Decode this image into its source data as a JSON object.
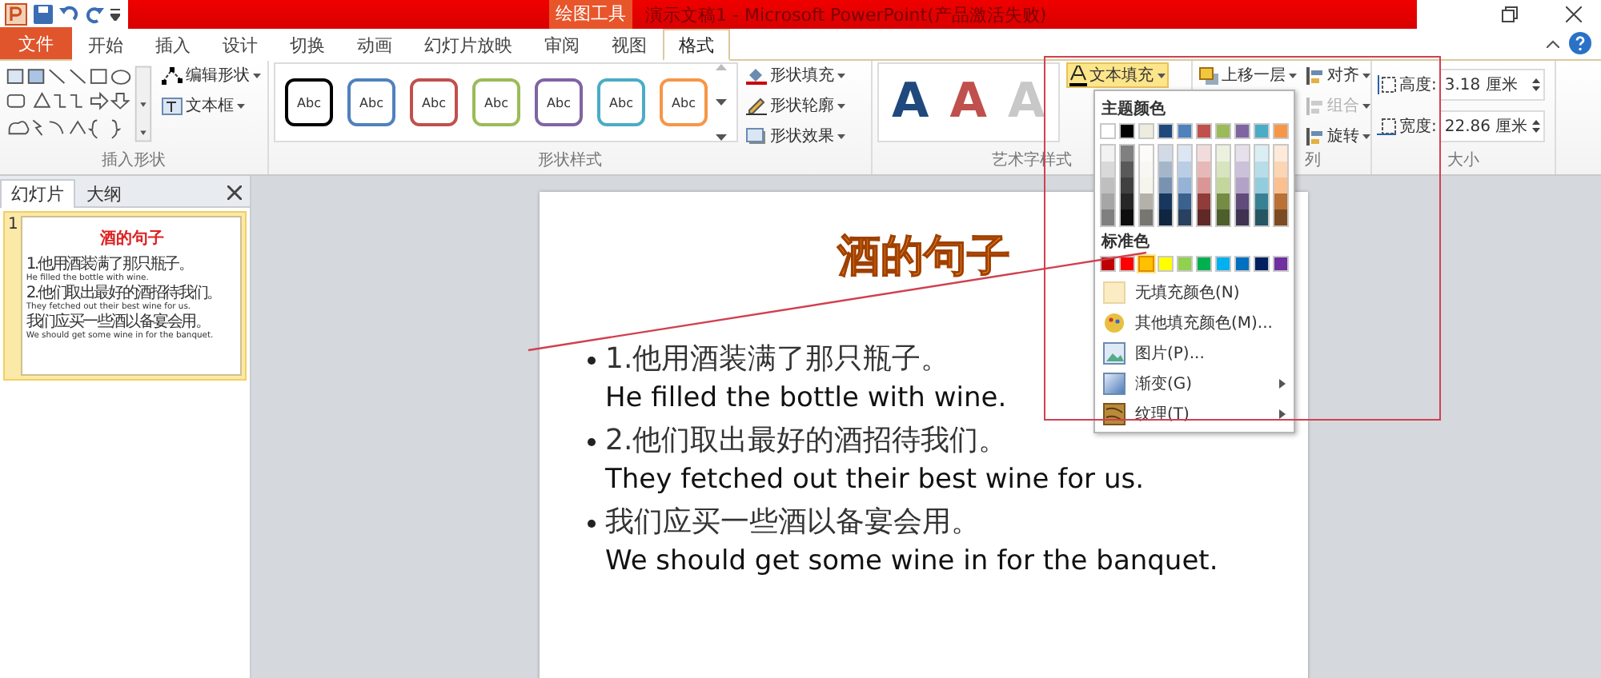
{
  "title_bar": {
    "context_label": "绘图工具",
    "title": "演示文稿1 - Microsoft PowerPoint(产品激活失败)"
  },
  "ribbon_tabs": [
    {
      "label": "文件",
      "kind": "file",
      "selected": false
    },
    {
      "label": "开始",
      "kind": "tab",
      "selected": false
    },
    {
      "label": "插入",
      "kind": "tab",
      "selected": false
    },
    {
      "label": "设计",
      "kind": "tab",
      "selected": false
    },
    {
      "label": "切换",
      "kind": "tab",
      "selected": false
    },
    {
      "label": "动画",
      "kind": "tab",
      "selected": false
    },
    {
      "label": "幻灯片放映",
      "kind": "tab",
      "selected": false
    },
    {
      "label": "审阅",
      "kind": "tab",
      "selected": false
    },
    {
      "label": "视图",
      "kind": "tab",
      "selected": false
    },
    {
      "label": "格式",
      "kind": "tab",
      "selected": true
    }
  ],
  "insert_shapes": {
    "label": "插入形状",
    "buttons": [
      "编辑形状",
      "文本框"
    ]
  },
  "shape_styles": {
    "label": "形状样式",
    "styles": [
      {
        "label": "Abc",
        "color": "#000000"
      },
      {
        "label": "Abc",
        "color": "#4f81bd"
      },
      {
        "label": "Abc",
        "color": "#c0504d"
      },
      {
        "label": "Abc",
        "color": "#9bbb59"
      },
      {
        "label": "Abc",
        "color": "#8064a2"
      },
      {
        "label": "Abc",
        "color": "#4bacc6"
      },
      {
        "label": "Abc",
        "color": "#f79646"
      }
    ],
    "buttons": [
      "形状填充",
      "形状轮廓",
      "形状效果"
    ]
  },
  "wordart_styles": {
    "label": "艺术字样式",
    "letters": [
      {
        "label": "A",
        "color": "#1f497d"
      },
      {
        "label": "A",
        "color": "#c0504d"
      },
      {
        "label": "A",
        "color": "#c8c8c8"
      }
    ],
    "text_fill_button": "文本填充"
  },
  "arrange": {
    "label": "列",
    "buttons": [
      {
        "label": "上移一层",
        "disabled": false
      },
      {
        "label": "对齐",
        "disabled": false
      },
      {
        "label": "组合",
        "disabled": true
      },
      {
        "label": "旋转",
        "disabled": false
      }
    ]
  },
  "size": {
    "label": "大小",
    "height_label": "高度:",
    "height": "3.18 厘米",
    "width_label": "宽度:",
    "width": "22.86 厘米"
  },
  "slide_panel": {
    "tabs": [
      {
        "label": "幻灯片",
        "selected": true
      },
      {
        "label": "大纲",
        "selected": false
      }
    ],
    "slide_number": "1",
    "thumbnail": {
      "title": "酒的句子",
      "bullets": [
        {
          "zh": "1.他用酒装满了那只瓶子。",
          "en": "He filled the bottle with wine."
        },
        {
          "zh": "2.他们取出最好的酒招待我们。",
          "en": "They fetched out their best wine for us."
        },
        {
          "zh": "我们应买一些酒以备宴会用。",
          "en": "We should get some wine in for the banquet."
        }
      ]
    }
  },
  "slide": {
    "title": "酒的句子",
    "bullets": [
      {
        "zh": "1.他用酒装满了那只瓶子。",
        "en": "He filled the bottle with wine."
      },
      {
        "zh": "2.他们取出最好的酒招待我们。",
        "en": "They fetched out their best wine for us."
      },
      {
        "zh": "我们应买一些酒以备宴会用。",
        "en": "We should get some wine in for the banquet."
      }
    ]
  },
  "fill_menu": {
    "theme_heading": "主题颜色",
    "theme_colors": [
      {
        "color": "#ffffff"
      },
      {
        "color": "#000000"
      },
      {
        "color": "#eeece1"
      },
      {
        "color": "#1f497d"
      },
      {
        "color": "#4f81bd"
      },
      {
        "color": "#c0504d"
      },
      {
        "color": "#9bbb59"
      },
      {
        "color": "#8064a2"
      },
      {
        "color": "#4bacc6"
      },
      {
        "color": "#f79646"
      }
    ],
    "standard_heading": "标准色",
    "standard_colors": [
      {
        "color": "#c00000",
        "selected": false
      },
      {
        "color": "#ff0000",
        "selected": false
      },
      {
        "color": "#ffc000",
        "selected": true
      },
      {
        "color": "#ffff00",
        "selected": false
      },
      {
        "color": "#92d050",
        "selected": false
      },
      {
        "color": "#00b050",
        "selected": false
      },
      {
        "color": "#00b0f0",
        "selected": false
      },
      {
        "color": "#0070c0",
        "selected": false
      },
      {
        "color": "#002060",
        "selected": false
      },
      {
        "color": "#7030a0",
        "selected": false
      }
    ],
    "items": [
      {
        "label": "无填充颜色(N)",
        "kind": "none",
        "submenu": false
      },
      {
        "label": "其他填充颜色(M)...",
        "kind": "palette",
        "submenu": false
      },
      {
        "label": "图片(P)...",
        "kind": "picture",
        "submenu": false
      },
      {
        "label": "渐变(G)",
        "kind": "gradient",
        "submenu": true
      },
      {
        "label": "纹理(T)",
        "kind": "texture",
        "submenu": true
      }
    ]
  }
}
